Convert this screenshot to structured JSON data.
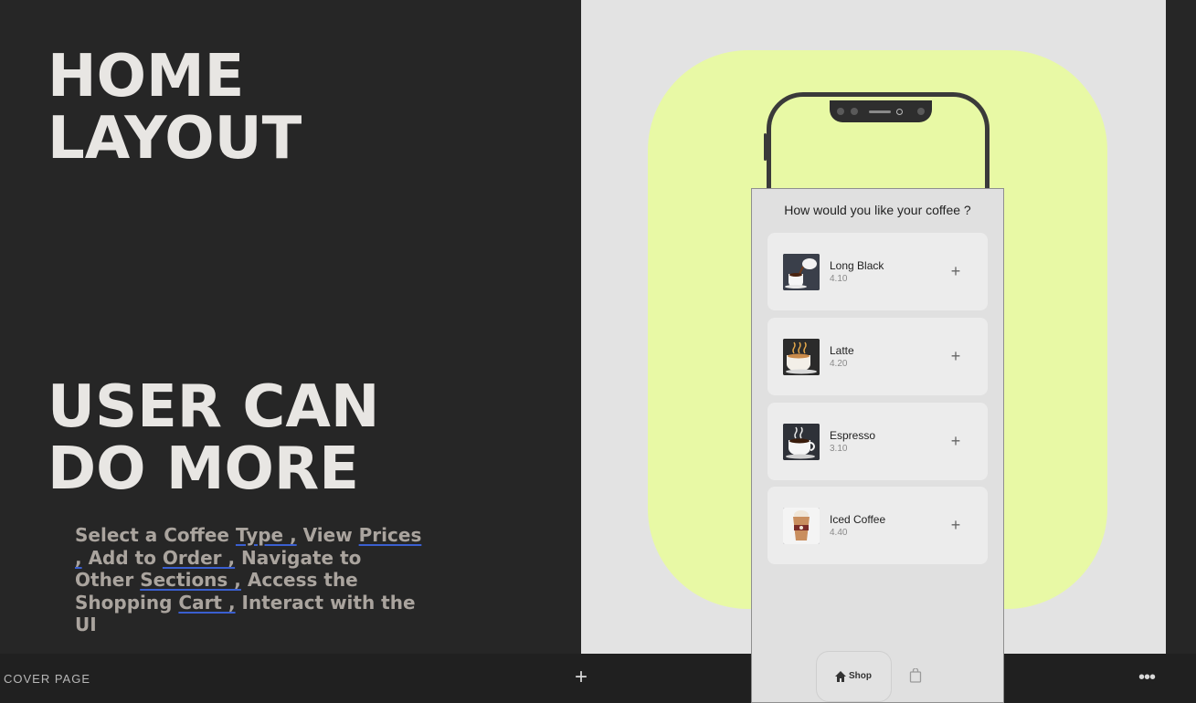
{
  "slide": {
    "title_lines": [
      "HOME",
      "LAYOUT"
    ],
    "subtitle_lines": [
      "USER CAN",
      "DO MORE"
    ],
    "description": {
      "parts": [
        {
          "text": "Select a Coffee ",
          "link": false
        },
        {
          "text": "Type ,",
          "link": true
        },
        {
          "text": " View ",
          "link": false
        },
        {
          "text": "Prices ,",
          "link": true
        },
        {
          "text": " Add to ",
          "link": false
        },
        {
          "text": "Order ,",
          "link": true
        },
        {
          "text": " Navigate to Other ",
          "link": false
        },
        {
          "text": "Sections ,",
          "link": true
        },
        {
          "text": " Access the Shopping ",
          "link": false
        },
        {
          "text": "Cart ,",
          "link": true
        },
        {
          "text": " Interact with the UI",
          "link": false
        }
      ]
    }
  },
  "app": {
    "heading": "How would you like your coffee ?",
    "items": [
      {
        "name": "Long Black",
        "price": "4.10",
        "icon": "coffee-pour-icon",
        "add": "+"
      },
      {
        "name": "Latte",
        "price": "4.20",
        "icon": "latte-cup-icon",
        "add": "+"
      },
      {
        "name": "Espresso",
        "price": "3.10",
        "icon": "espresso-cup-icon",
        "add": "+"
      },
      {
        "name": "Iced Coffee",
        "price": "4.40",
        "icon": "iced-coffee-cup-icon",
        "add": "+"
      }
    ],
    "tabs": {
      "shop_label": "Shop",
      "shop_icon": "home-icon",
      "cart_icon": "shopping-bag-icon"
    }
  },
  "toolbar": {
    "page_label": "COVER PAGE",
    "add_label": "+",
    "more_label": "•••"
  },
  "colors": {
    "accent_blob": "#e8f9a5",
    "link_underline": "#3a5fd0",
    "background": "#262626"
  }
}
